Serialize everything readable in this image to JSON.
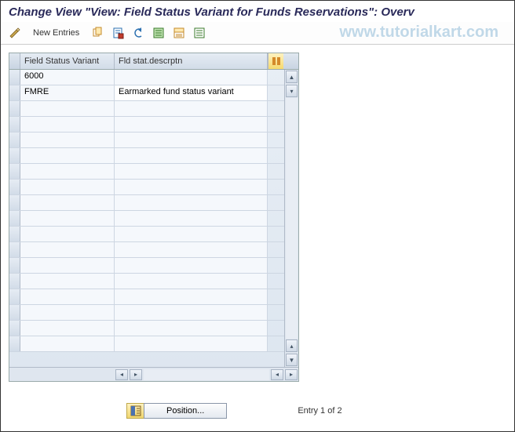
{
  "title": "Change View \"View: Field Status Variant for Funds Reservations\": Overv",
  "toolbar": {
    "new_entries": "New Entries"
  },
  "watermark": "www.tutorialkart.com",
  "grid": {
    "col1_header": "Field Status Variant",
    "col2_header": "Fld stat.descrptn",
    "rows": [
      {
        "variant": "6000",
        "desc": ""
      },
      {
        "variant": "FMRE",
        "desc": "Earmarked fund status variant"
      },
      {
        "variant": "",
        "desc": ""
      },
      {
        "variant": "",
        "desc": ""
      },
      {
        "variant": "",
        "desc": ""
      },
      {
        "variant": "",
        "desc": ""
      },
      {
        "variant": "",
        "desc": ""
      },
      {
        "variant": "",
        "desc": ""
      },
      {
        "variant": "",
        "desc": ""
      },
      {
        "variant": "",
        "desc": ""
      },
      {
        "variant": "",
        "desc": ""
      },
      {
        "variant": "",
        "desc": ""
      },
      {
        "variant": "",
        "desc": ""
      },
      {
        "variant": "",
        "desc": ""
      },
      {
        "variant": "",
        "desc": ""
      },
      {
        "variant": "",
        "desc": ""
      },
      {
        "variant": "",
        "desc": ""
      },
      {
        "variant": "",
        "desc": ""
      }
    ]
  },
  "footer": {
    "position_label": "Position...",
    "entry_text": "Entry 1 of 2"
  }
}
